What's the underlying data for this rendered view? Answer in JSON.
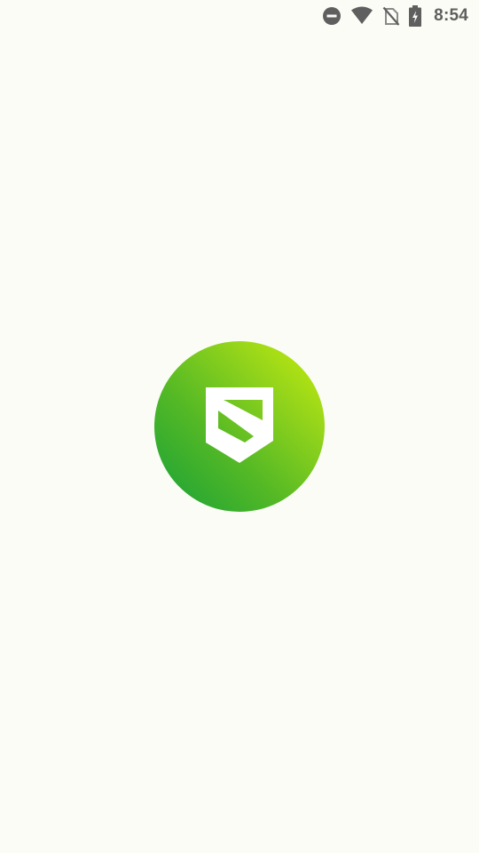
{
  "status_bar": {
    "time": "8:54",
    "icons": [
      "do-not-disturb-icon",
      "wifi-icon",
      "no-sim-icon",
      "battery-charging-icon"
    ]
  },
  "splash": {
    "logo": "brand-logo-icon",
    "colors": {
      "background": "#fbfcf6",
      "gradient_start": "#16a038",
      "gradient_end": "#c8ee08",
      "status_icon": "#5f5f5f"
    }
  }
}
